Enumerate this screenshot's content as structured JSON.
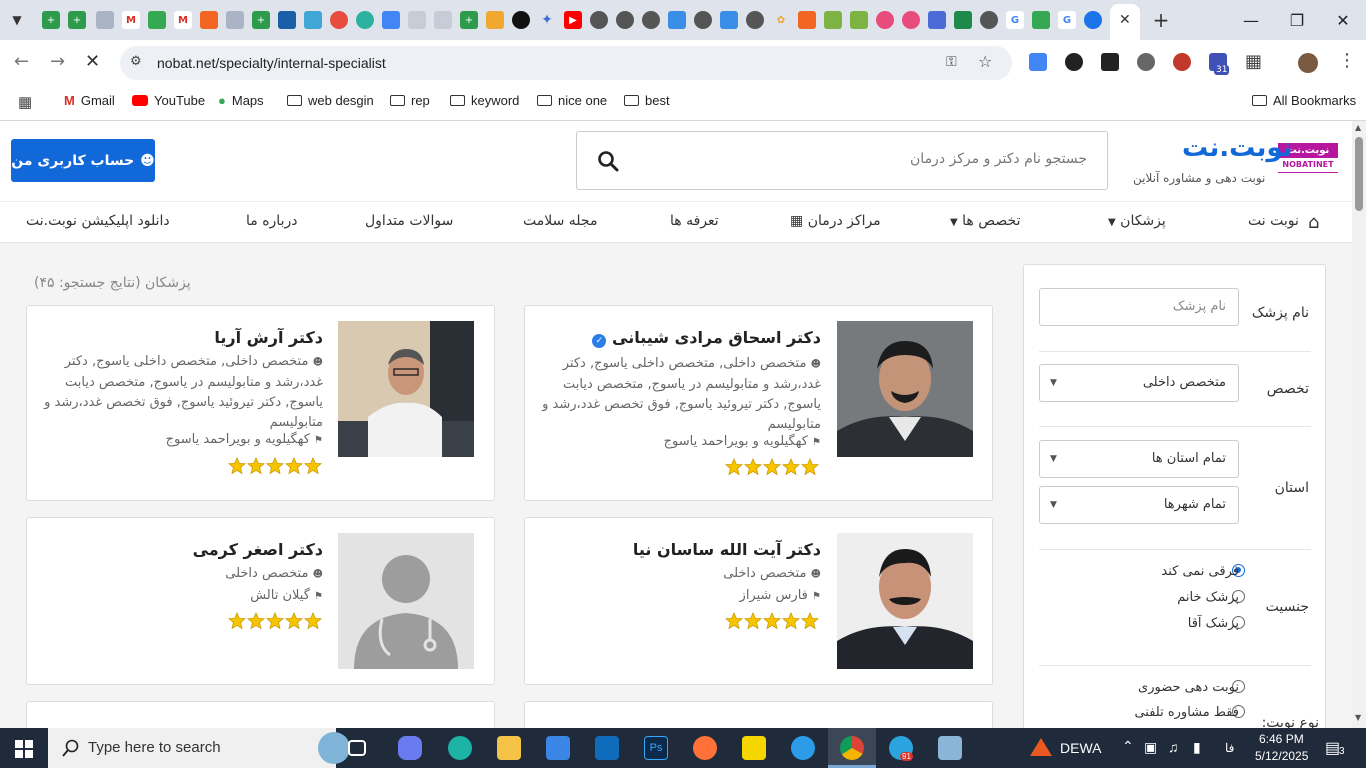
{
  "browser": {
    "url": "nobat.net/specialty/internal-specialist",
    "bookmarks": [
      "Gmail",
      "YouTube",
      "Maps",
      "web desgin",
      "rep",
      "keyword",
      "nice one",
      "best"
    ],
    "all_bookmarks": "All Bookmarks",
    "ext_badge": "31"
  },
  "site": {
    "logo_name": "نوبت.نت",
    "logo_badge_top": "نوبت.نت",
    "logo_badge_bottom": "NOBATINET",
    "tagline": "نوبت دهی و مشاوره آنلاین",
    "search_placeholder": "جستجو نام دکتر و مرکز درمان",
    "account_button": "حساب کاربری من"
  },
  "nav": [
    "نوبت نت",
    "پزشکان",
    "تخصص ها",
    "مراکز درمان",
    "تعرفه ها",
    "مجله سلامت",
    "سوالات متداول",
    "درباره ما",
    "دانلود اپلیکیشن نوبت.نت"
  ],
  "filters": {
    "name_label": "نام پزشک",
    "name_placeholder": "نام پزشک",
    "specialty_label": "تخصص",
    "specialty_value": "متخصص داخلی",
    "province_label": "استان",
    "province_value": "تمام استان ها",
    "city_value": "تمام شهرها",
    "gender_label": "جنسیت",
    "gender_options": [
      "فرقی نمی کند",
      "پزشک خانم",
      "پزشک آقا"
    ],
    "appointment_label": "نوع نوبت:",
    "appointment_options": [
      "نوبت دهی حضوری",
      "فقط مشاوره تلفنی"
    ]
  },
  "results_count": "پزشکان (نتایج جستجو: ۴۵)",
  "doctors": [
    {
      "name": "دکتر اسحاق مرادی شیبانی",
      "specialty": "متخصص داخلی,  متخصص داخلی یاسوج,  دکتر غدد،رشد و متابولیسم در یاسوج,  متخصص دیابت یاسوج,  دکتر تیروئید یاسوج,  فوق تخصص غدد،رشد و متابولیسم",
      "location": "کهگیلویه و بویراحمد یاسوج",
      "rating": 5,
      "verified": true
    },
    {
      "name": "دکتر آرش آریا",
      "specialty": "متخصص داخلی,  متخصص داخلی یاسوج,  دکتر غدد،رشد و متابولیسم در یاسوج,  متخصص دیابت یاسوج,  دکتر تیروئید یاسوج,  فوق تخصص غدد،رشد و متابولیسم",
      "location": "کهگیلویه و بویراحمد یاسوج",
      "rating": 5
    },
    {
      "name": "دکتر آیت الله ساسان نیا",
      "specialty": "متخصص داخلی",
      "location": "فارس شیراز",
      "rating": 5
    },
    {
      "name": "دکتر اصغر کرمی",
      "specialty": "متخصص داخلی",
      "location": "گیلان تالش",
      "rating": 5
    }
  ],
  "taskbar": {
    "search_placeholder": "Type here to search",
    "weather": "DEWA",
    "lang": "فا",
    "time": "6:46 PM",
    "date": "5/12/2025",
    "notif_count": "3",
    "telegram_badge": "91"
  }
}
